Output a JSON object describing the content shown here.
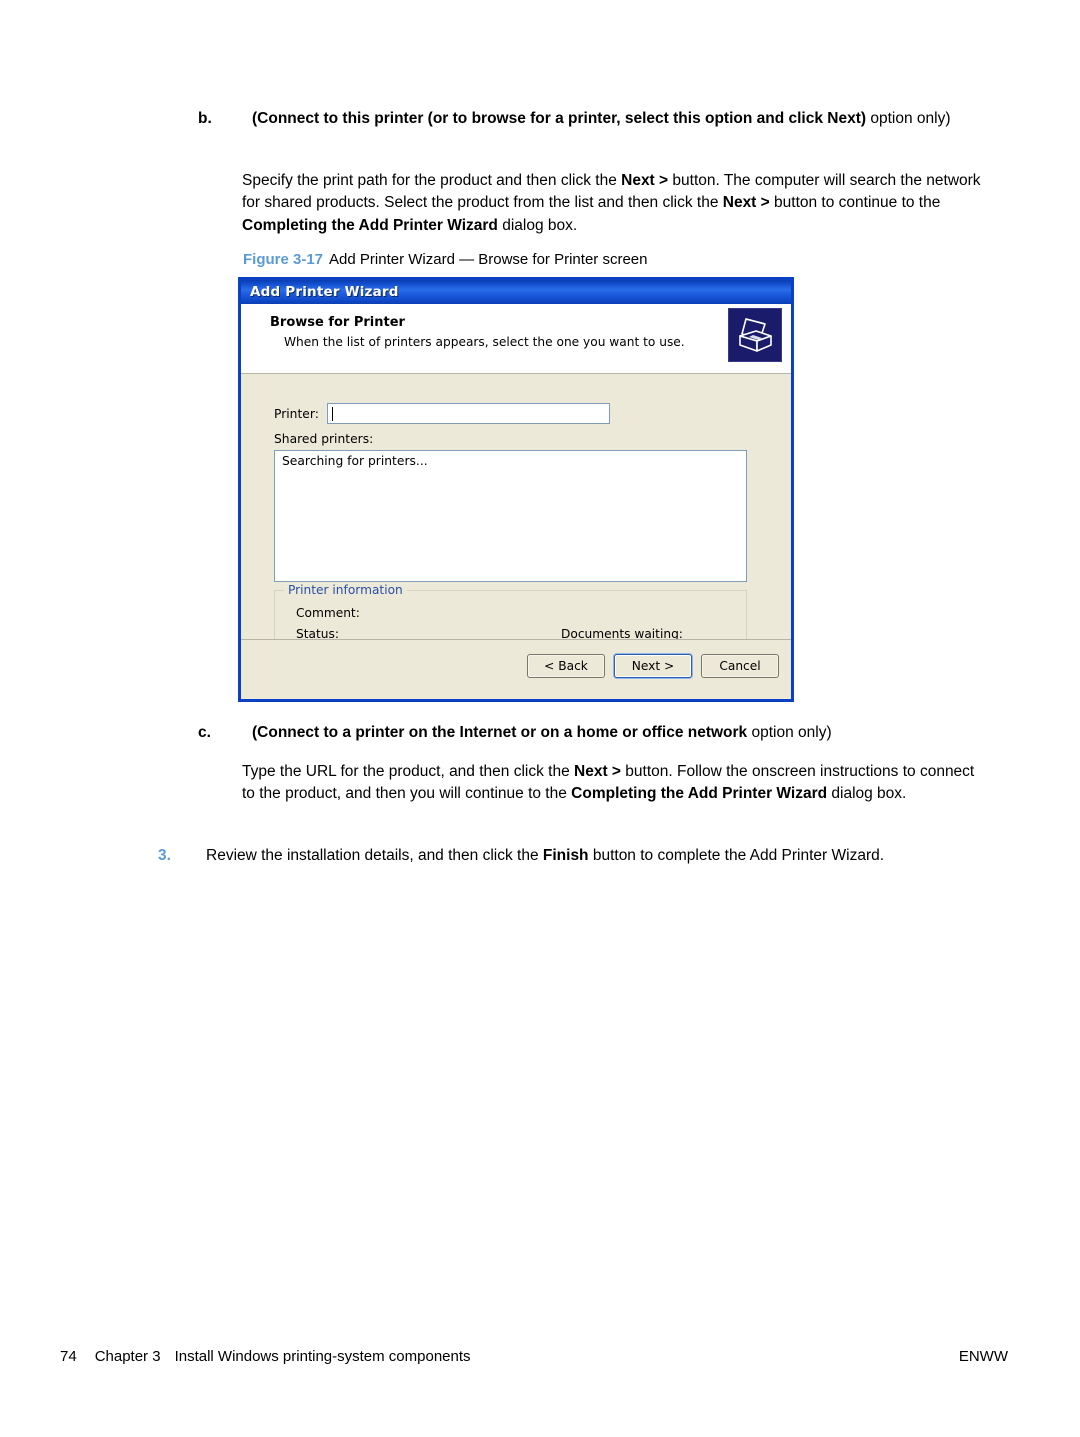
{
  "page": {
    "number": "74",
    "chapter": "Chapter 3",
    "chapter_title": "Install Windows printing-system components",
    "footer_right": "ENWW"
  },
  "steps": {
    "b": {
      "marker": "b.",
      "heading_bold": "(Connect to this printer (or to browse for a printer, select this option and click Next)",
      "heading_rest": " option only)",
      "paragraph": {
        "t1": "Specify the print path for the product and then click the ",
        "b1": "Next >",
        "t2": " button. The computer will search the network for shared products. Select the product from the list and then click the ",
        "b2": "Next >",
        "t3": " button to continue to the ",
        "b3": "Completing the Add Printer Wizard",
        "t4": " dialog box."
      }
    },
    "c": {
      "marker": "c.",
      "heading_bold": "(Connect to a printer on the Internet or on a home or office network",
      "heading_rest": " option only)",
      "paragraph": {
        "t1": "Type the URL for the product, and then click the ",
        "b1": "Next >",
        "t2": " button. Follow the onscreen instructions to connect to the product, and then you will continue to the ",
        "b2": "Completing the Add Printer Wizard",
        "t3": " dialog box."
      }
    },
    "three": {
      "marker": "3.",
      "t1": "Review the installation details, and then click the ",
      "b1": "Finish",
      "t2": " button to complete the Add Printer Wizard."
    }
  },
  "figure": {
    "label": "Figure 3-17",
    "caption": "Add Printer Wizard — Browse for Printer screen"
  },
  "dialog": {
    "title": "Add Printer Wizard",
    "header_title": "Browse for Printer",
    "header_subtitle": "When the list of printers appears, select the one you want to use.",
    "icon": "printer-icon",
    "printer_label": "Printer:",
    "printer_value": "",
    "shared_printers_label": "Shared printers:",
    "list_items": [
      "Searching for printers..."
    ],
    "group": {
      "legend": "Printer information",
      "comment_label": "Comment:",
      "comment_value": "",
      "status_label": "Status:",
      "status_value": "",
      "documents_label": "Documents waiting:",
      "documents_value": ""
    },
    "buttons": {
      "back": "< Back",
      "next": "Next >",
      "cancel": "Cancel"
    }
  },
  "colors": {
    "accent_blue": "#5b9bd5",
    "titlebar_blue": "#1049c8",
    "dialog_border": "#0b3fc4",
    "dialog_face": "#ece9d8",
    "groupbox_legend": "#2b4fa8"
  }
}
